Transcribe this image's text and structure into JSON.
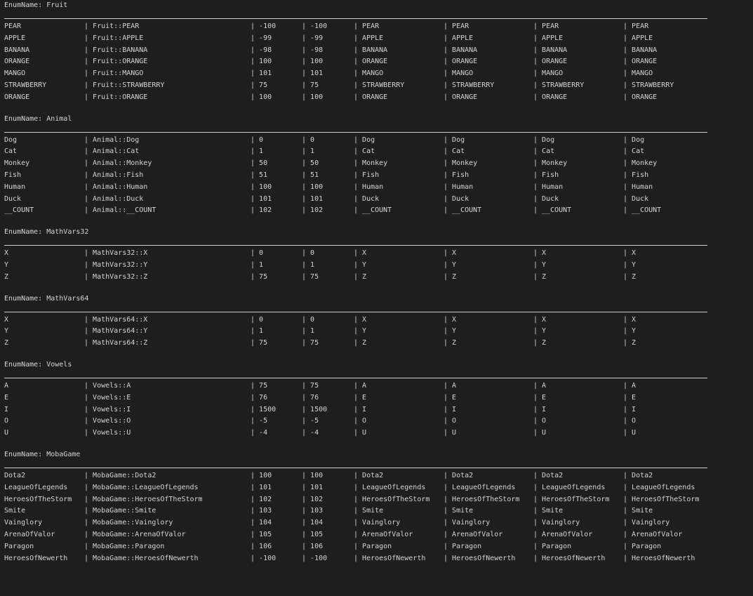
{
  "header_prefix": "EnumName: ",
  "separator": "| ",
  "enums": [
    {
      "name": "Fruit",
      "rows": [
        [
          "PEAR",
          "Fruit::PEAR",
          "-100",
          "-100",
          "PEAR",
          "PEAR",
          "PEAR",
          "PEAR"
        ],
        [
          "APPLE",
          "Fruit::APPLE",
          "-99",
          "-99",
          "APPLE",
          "APPLE",
          "APPLE",
          "APPLE"
        ],
        [
          "BANANA",
          "Fruit::BANANA",
          "-98",
          "-98",
          "BANANA",
          "BANANA",
          "BANANA",
          "BANANA"
        ],
        [
          "ORANGE",
          "Fruit::ORANGE",
          "100",
          "100",
          "ORANGE",
          "ORANGE",
          "ORANGE",
          "ORANGE"
        ],
        [
          "MANGO",
          "Fruit::MANGO",
          "101",
          "101",
          "MANGO",
          "MANGO",
          "MANGO",
          "MANGO"
        ],
        [
          "STRAWBERRY",
          "Fruit::STRAWBERRY",
          "75",
          "75",
          "STRAWBERRY",
          "STRAWBERRY",
          "STRAWBERRY",
          "STRAWBERRY"
        ],
        [
          "ORANGE",
          "Fruit::ORANGE",
          "100",
          "100",
          "ORANGE",
          "ORANGE",
          "ORANGE",
          "ORANGE"
        ]
      ]
    },
    {
      "name": "Animal",
      "rows": [
        [
          "Dog",
          "Animal::Dog",
          "0",
          "0",
          "Dog",
          "Dog",
          "Dog",
          "Dog"
        ],
        [
          "Cat",
          "Animal::Cat",
          "1",
          "1",
          "Cat",
          "Cat",
          "Cat",
          "Cat"
        ],
        [
          "Monkey",
          "Animal::Monkey",
          "50",
          "50",
          "Monkey",
          "Monkey",
          "Monkey",
          "Monkey"
        ],
        [
          "Fish",
          "Animal::Fish",
          "51",
          "51",
          "Fish",
          "Fish",
          "Fish",
          "Fish"
        ],
        [
          "Human",
          "Animal::Human",
          "100",
          "100",
          "Human",
          "Human",
          "Human",
          "Human"
        ],
        [
          "Duck",
          "Animal::Duck",
          "101",
          "101",
          "Duck",
          "Duck",
          "Duck",
          "Duck"
        ],
        [
          "__COUNT",
          "Animal::__COUNT",
          "102",
          "102",
          "__COUNT",
          "__COUNT",
          "__COUNT",
          "__COUNT"
        ]
      ]
    },
    {
      "name": "MathVars32",
      "rows": [
        [
          "X",
          "MathVars32::X",
          "0",
          "0",
          "X",
          "X",
          "X",
          "X"
        ],
        [
          "Y",
          "MathVars32::Y",
          "1",
          "1",
          "Y",
          "Y",
          "Y",
          "Y"
        ],
        [
          "Z",
          "MathVars32::Z",
          "75",
          "75",
          "Z",
          "Z",
          "Z",
          "Z"
        ]
      ]
    },
    {
      "name": "MathVars64",
      "rows": [
        [
          "X",
          "MathVars64::X",
          "0",
          "0",
          "X",
          "X",
          "X",
          "X"
        ],
        [
          "Y",
          "MathVars64::Y",
          "1",
          "1",
          "Y",
          "Y",
          "Y",
          "Y"
        ],
        [
          "Z",
          "MathVars64::Z",
          "75",
          "75",
          "Z",
          "Z",
          "Z",
          "Z"
        ]
      ]
    },
    {
      "name": "Vowels",
      "rows": [
        [
          "A",
          "Vowels::A",
          "75",
          "75",
          "A",
          "A",
          "A",
          "A"
        ],
        [
          "E",
          "Vowels::E",
          "76",
          "76",
          "E",
          "E",
          "E",
          "E"
        ],
        [
          "I",
          "Vowels::I",
          "1500",
          "1500",
          "I",
          "I",
          "I",
          "I"
        ],
        [
          "O",
          "Vowels::O",
          "-5",
          "-5",
          "O",
          "O",
          "O",
          "O"
        ],
        [
          "U",
          "Vowels::U",
          "-4",
          "-4",
          "U",
          "U",
          "U",
          "U"
        ]
      ]
    },
    {
      "name": "MobaGame",
      "rows": [
        [
          "Dota2",
          "MobaGame::Dota2",
          "100",
          "100",
          "Dota2",
          "Dota2",
          "Dota2",
          "Dota2"
        ],
        [
          "LeagueOfLegends",
          "MobaGame::LeagueOfLegends",
          "101",
          "101",
          "LeagueOfLegends",
          "LeagueOfLegends",
          "LeagueOfLegends",
          "LeagueOfLegends"
        ],
        [
          "HeroesOfTheStorm",
          "MobaGame::HeroesOfTheStorm",
          "102",
          "102",
          "HeroesOfTheStorm",
          "HeroesOfTheStorm",
          "HeroesOfTheStorm",
          "HeroesOfTheStorm"
        ],
        [
          "Smite",
          "MobaGame::Smite",
          "103",
          "103",
          "Smite",
          "Smite",
          "Smite",
          "Smite"
        ],
        [
          "Vainglory",
          "MobaGame::Vainglory",
          "104",
          "104",
          "Vainglory",
          "Vainglory",
          "Vainglory",
          "Vainglory"
        ],
        [
          "ArenaOfValor",
          "MobaGame::ArenaOfValor",
          "105",
          "105",
          "ArenaOfValor",
          "ArenaOfValor",
          "ArenaOfValor",
          "ArenaOfValor"
        ],
        [
          "Paragon",
          "MobaGame::Paragon",
          "106",
          "106",
          "Paragon",
          "Paragon",
          "Paragon",
          "Paragon"
        ],
        [
          "HeroesOfNewerth",
          "MobaGame::HeroesOfNewerth",
          "-100",
          "-100",
          "HeroesOfNewerth",
          "HeroesOfNewerth",
          "HeroesOfNewerth",
          "HeroesOfNewerth"
        ]
      ]
    }
  ]
}
